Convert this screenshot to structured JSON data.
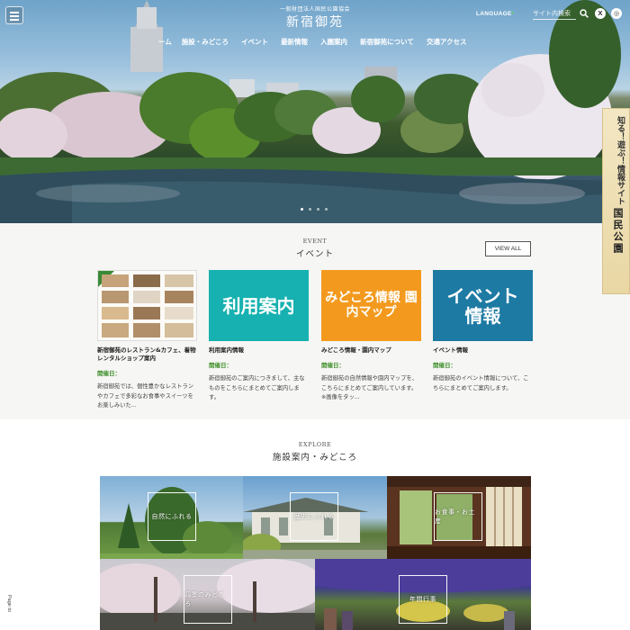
{
  "header": {
    "org_name": "一般財団法人国民公園協会",
    "site_name": "新宿御苑",
    "language_label": "LANGUAGE",
    "search_placeholder": "サイト内検索",
    "x_icon_glyph": "X",
    "instagram_icon_glyph": "◎"
  },
  "nav": {
    "items": [
      {
        "label": "ーム"
      },
      {
        "label": "施設・みどころ"
      },
      {
        "label": "イベント"
      },
      {
        "label": "最新情報"
      },
      {
        "label": "入園案内"
      },
      {
        "label": "新宿御苑について"
      },
      {
        "label": "交通アクセス"
      }
    ]
  },
  "hero": {
    "slide_count": 4,
    "active_slide": 1,
    "side_banner_line1": "知る！遊ぶ！情報サイト",
    "side_banner_line2": "国民公園"
  },
  "events": {
    "heading_en": "EVENT",
    "heading_jp": "イベント",
    "view_all_label": "VIEW ALL",
    "cards": [
      {
        "thumb_text": "",
        "title": "新宿御苑のレストラン&カフェ、着物レンタルショップ案内",
        "date_label": "開催日：",
        "desc": "新宿御苑では、個性豊かなレストランやカフェで多彩なお食事やスイーツをお楽しみいた..."
      },
      {
        "thumb_text": "利用案内",
        "title": "利用案内情報",
        "date_label": "開催日：",
        "desc": "新宿御苑のご案内につきまして、主なものをこちらにまとめてご案内します。"
      },
      {
        "thumb_text": "みどころ情報 園内マップ",
        "title": "みどころ情報・園内マップ",
        "date_label": "開催日：",
        "desc": "新宿御苑の自然情報や園内マップを、こちらにまとめてご案内しています。※画像をタッ..."
      },
      {
        "thumb_text": "イベント 情報",
        "title": "イベント情報",
        "date_label": "開催日：",
        "desc": "新宿御苑のイベント情報について、こちらにまとめてご案内します。"
      }
    ]
  },
  "explore": {
    "heading_en": "EXPLORE",
    "heading_jp": "施設案内・みどころ",
    "tiles": [
      {
        "label": "自然にふれる"
      },
      {
        "label": "歴史にふれる"
      },
      {
        "label": "お食事・お土産"
      },
      {
        "label": "四季のみどころ"
      },
      {
        "label": "年間行事"
      }
    ]
  },
  "page_top_label": "Page to",
  "colors": {
    "card_teal": "#16b1b0",
    "card_orange": "#f39a1e",
    "card_blue": "#1d7aa3",
    "date_green": "#3f8f2a"
  }
}
